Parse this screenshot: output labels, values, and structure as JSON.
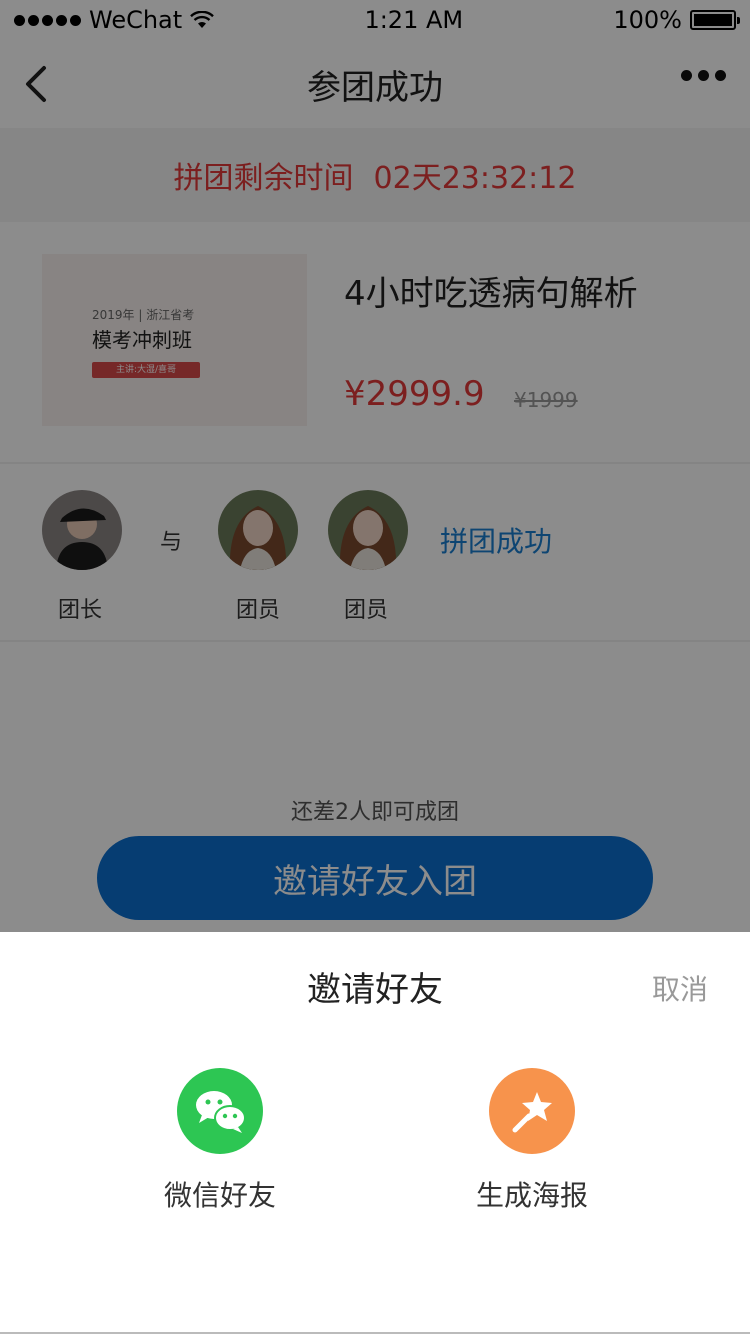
{
  "status_bar": {
    "carrier": "WeChat",
    "time": "1:21 AM",
    "battery": "100%"
  },
  "nav": {
    "title": "参团成功"
  },
  "timer": {
    "label": "拼团剩余时间",
    "countdown": "02天23:32:12"
  },
  "product": {
    "image_line1": "2019年 | 浙江省考",
    "image_line2": "模考冲刺班",
    "image_tag": "主讲:大湿/喜哥",
    "name": "4小时吃透病句解析",
    "price": "¥2999.9",
    "old_price": "¥1999"
  },
  "members": {
    "leader_label": "团长",
    "and_text": "与",
    "member1_label": "团员",
    "member2_label": "团员",
    "status": "拼团成功"
  },
  "remaining_text": "还差2人即可成团",
  "invite_button": "邀请好友入团",
  "sheet": {
    "title": "邀请好友",
    "cancel": "取消",
    "options": [
      {
        "label": "微信好友",
        "icon": "wechat-icon",
        "color": "#2dc653"
      },
      {
        "label": "生成海报",
        "icon": "magic-wand-star-icon",
        "color": "#f7934c"
      }
    ]
  }
}
